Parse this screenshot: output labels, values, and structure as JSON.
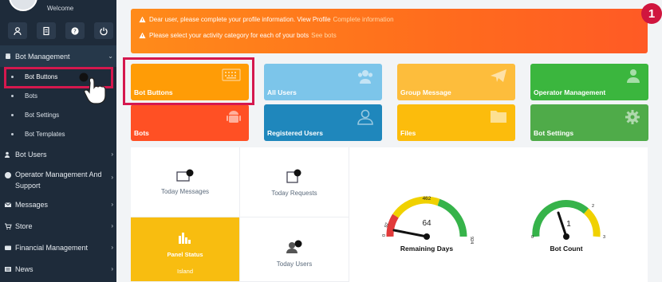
{
  "sidebar": {
    "welcome": "Welcome",
    "quick_icons": [
      "user-icon",
      "document-icon",
      "help-icon",
      "power-icon"
    ],
    "bot_management": "Bot Management",
    "sub_items": [
      "Bot Buttons",
      "Bots",
      "Bot Settings",
      "Bot Templates"
    ],
    "items": [
      {
        "label": "Bot Users"
      },
      {
        "label": "Operator Management And Support"
      },
      {
        "label": "Messages"
      },
      {
        "label": "Store"
      },
      {
        "label": "Financial Management"
      },
      {
        "label": "News"
      }
    ]
  },
  "alert": {
    "line1": "Dear user, please complete your profile information. View Profile",
    "line1_link": "Complete information",
    "line2": "Please select your activity category for each of your bots",
    "line2_link": "See bots",
    "step_badge": "1"
  },
  "tiles": [
    {
      "label": "Bot Buttons",
      "color": "#ff9c06"
    },
    {
      "label": "All Users",
      "color": "#7cc5ea"
    },
    {
      "label": "Group Message",
      "color": "#fdbd3c"
    },
    {
      "label": "Operator Management",
      "color": "#3bb63e"
    },
    {
      "label": "Bots",
      "color": "#ff5024"
    },
    {
      "label": "Registered Users",
      "color": "#1f87bc"
    },
    {
      "label": "Files",
      "color": "#fcbc0c"
    },
    {
      "label": "Bot Settings",
      "color": "#4fab49"
    }
  ],
  "stats": {
    "today_messages": "Today Messages",
    "today_requests": "Today Requests",
    "panel_status": "Panel Status",
    "panel_status_value": "Island",
    "today_users": "Today Users"
  },
  "gauges": {
    "remaining": {
      "title": "Remaining Days",
      "value": "64",
      "min": "0",
      "max": "924",
      "mid": "462",
      "low": "92"
    },
    "botcount": {
      "title": "Bot Count",
      "value": "1",
      "min": "0",
      "max": "3",
      "mid": "2"
    }
  }
}
